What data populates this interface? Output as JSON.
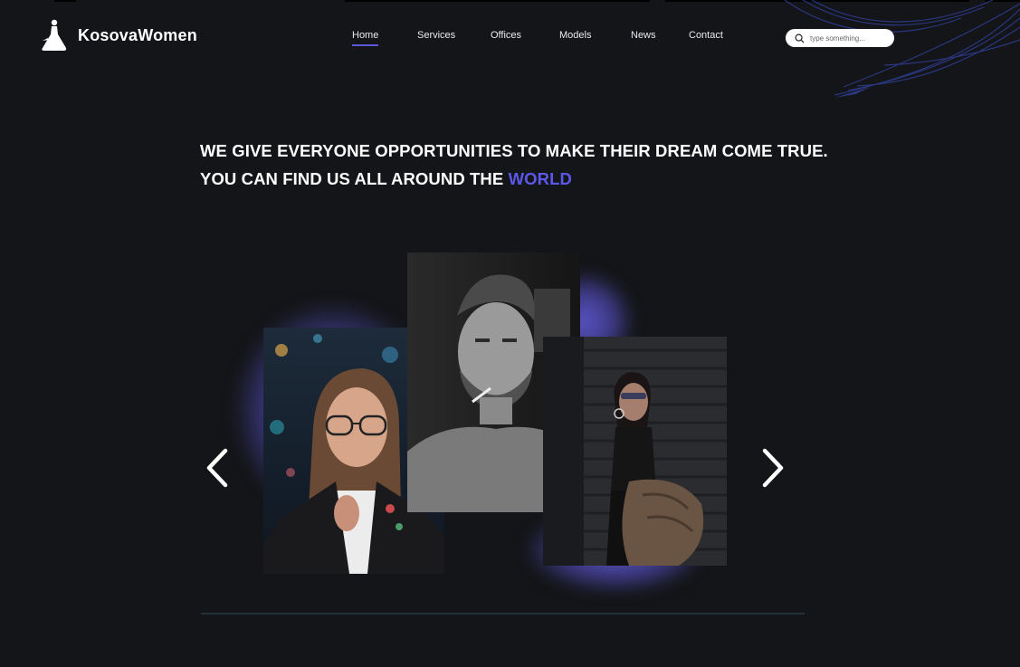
{
  "brand": {
    "name": "KosovaWomen"
  },
  "nav": {
    "items": [
      {
        "label": "Home",
        "active": true
      },
      {
        "label": "Services"
      },
      {
        "label": "Offices"
      },
      {
        "label": "Models"
      },
      {
        "label": "News"
      },
      {
        "label": "Contact"
      }
    ]
  },
  "search": {
    "placeholder": "type something..."
  },
  "hero": {
    "line1": "WE GIVE EVERYONE OPPORTUNITIES TO MAKE THEIR DREAM COME TRUE.",
    "line2_prefix": "YOU CAN FIND US ALL AROUND THE",
    "line2_accent": "WORLD"
  },
  "carousel": {
    "photos": [
      {
        "subject": "woman-with-glasses-leather-jacket"
      },
      {
        "subject": "man-with-cigarette-black-and-white"
      },
      {
        "subject": "woman-with-sunglasses-fur-coat"
      }
    ],
    "prev_icon": "chevron-left-icon",
    "next_icon": "chevron-right-icon"
  },
  "colors": {
    "background": "#141518",
    "accent": "#5b57e8",
    "glow": "#6660e6",
    "divider": "#22303c"
  }
}
